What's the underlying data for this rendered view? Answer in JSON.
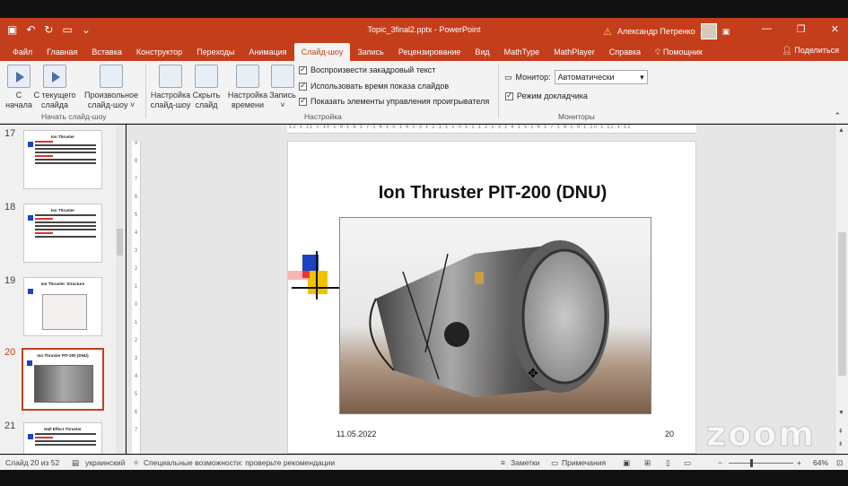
{
  "window": {
    "doc_title": "Topic_3final2.pptx - PowerPoint",
    "user_name": "Александр Петренко"
  },
  "tabs": [
    {
      "label": "Файл"
    },
    {
      "label": "Главная"
    },
    {
      "label": "Вставка"
    },
    {
      "label": "Конструктор"
    },
    {
      "label": "Переходы"
    },
    {
      "label": "Анимация"
    },
    {
      "label": "Слайд-шоу"
    },
    {
      "label": "Запись"
    },
    {
      "label": "Рецензирование"
    },
    {
      "label": "Вид"
    },
    {
      "label": "MathType"
    },
    {
      "label": "MathPlayer"
    },
    {
      "label": "Справка"
    },
    {
      "label": "Помощник"
    }
  ],
  "share_label": "Поделиться",
  "ribbon": {
    "from_start_1": "С",
    "from_start_2": "начала",
    "from_current_1": "С текущего",
    "from_current_2": "слайда",
    "custom_1": "Произвольное",
    "custom_2": "слайд-шоу ˅",
    "group_start": "Начать слайд-шоу",
    "setup_1": "Настройка",
    "setup_2": "слайд-шоу",
    "hide_1": "Скрыть",
    "hide_2": "слайд",
    "rehearse_1": "Настройка",
    "rehearse_2": "времени",
    "record_1": "Запись",
    "chk_narration": "Воспроизвести закадровый текст",
    "chk_timings": "Использовать время показа слайдов",
    "chk_controls": "Показать элементы управления проигрывателя",
    "group_setup": "Настройка",
    "monitor_label": "Монитор:",
    "monitor_value": "Автоматически",
    "presenter_view": "Режим докладчика",
    "group_monitors": "Мониторы"
  },
  "thumbnails": [
    {
      "num": "17",
      "title": "Ion Thruster"
    },
    {
      "num": "18",
      "title": "Ion Thruster"
    },
    {
      "num": "19",
      "title": "Ion Thruster. Structure"
    },
    {
      "num": "20",
      "title": "Ion Thruster PIT-200 (DNU)"
    },
    {
      "num": "21",
      "title": "Hall Effect Thruster"
    }
  ],
  "slide": {
    "title": "Ion Thruster PIT-200 (DNU)",
    "date": "11.05.2022",
    "page_number": "20"
  },
  "watermark": "zoom",
  "status": {
    "slide_info": "Слайд 20 из 52",
    "language": "украинский",
    "accessibility": "Специальные возможности: проверьте рекомендации",
    "notes": "Заметки",
    "comments": "Примечания",
    "zoom_level": "64%"
  },
  "colors": {
    "accent": "#c43e1c"
  }
}
